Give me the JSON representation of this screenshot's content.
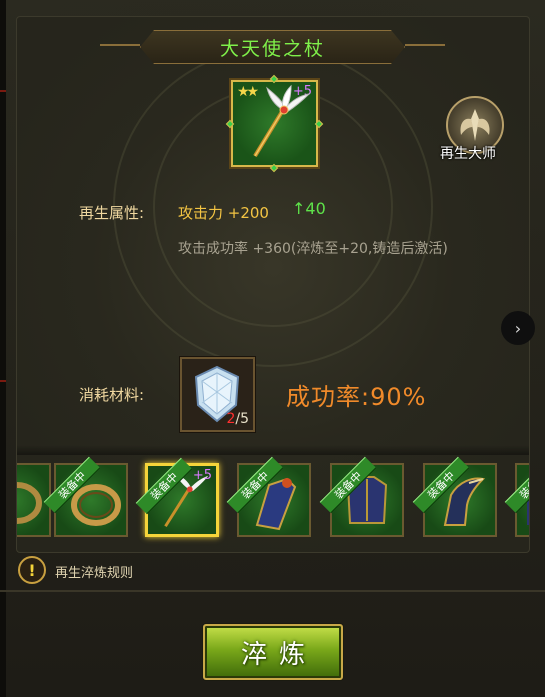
{
  "item_title": "大天使之杖",
  "main_item": {
    "stars": "★★",
    "plus": "+5"
  },
  "master": {
    "label": "再生大师",
    "icon": "wings-emblem-icon"
  },
  "attribute": {
    "label": "再生属性:",
    "value": "攻击力 +200",
    "increase": "40",
    "sub": "攻击成功率 +360(淬炼至+20,铸造后激活)"
  },
  "material": {
    "label": "消耗材料:",
    "current": "2",
    "total": "/5",
    "icon": "crystal-shield-icon"
  },
  "success_rate": "成功率:90%",
  "equipment_strip": {
    "tag": "装备中",
    "items": [
      {
        "icon": "ring-icon",
        "plus": ""
      },
      {
        "icon": "ring-icon",
        "plus": ""
      },
      {
        "icon": "staff-icon",
        "plus": "+5",
        "selected": true
      },
      {
        "icon": "shoulder-armor-icon",
        "plus": ""
      },
      {
        "icon": "chest-armor-icon",
        "plus": ""
      },
      {
        "icon": "gloves-icon",
        "plus": ""
      },
      {
        "icon": "armor-icon",
        "plus": ""
      }
    ]
  },
  "rules_link": "再生淬炼规则",
  "refine_button": "淬炼",
  "colors": {
    "title_green": "#7ff04a",
    "rate_orange": "#f08a2a",
    "attr_gold": "#f3c443",
    "slot_green": "#2f7a2a"
  }
}
